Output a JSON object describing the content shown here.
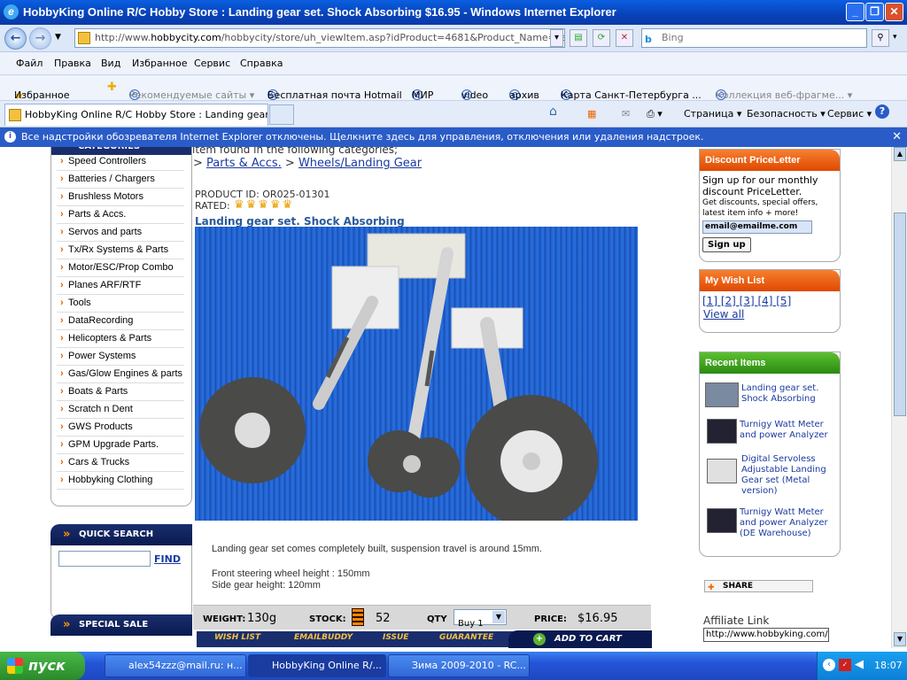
{
  "window": {
    "title": "HobbyKing Online R/C Hobby Store : Landing gear set. Shock Absorbing $16.95 - Windows Internet Explorer",
    "minimize": "_",
    "maximize": "❐",
    "close": "✕"
  },
  "address": {
    "url_prefix": "http://www.",
    "url_domain": "hobbycity.com",
    "url_rest": "/hobbycity/store/uh_viewItem.asp?idProduct=4681&Product_Name=Landing_g",
    "search_placeholder": "Bing"
  },
  "menu": [
    "Файл",
    "Правка",
    "Вид",
    "Избранное",
    "Сервис",
    "Справка"
  ],
  "favorites": {
    "label": "Избранное",
    "items": [
      "Рекомендуемые сайты ▾",
      "Бесплатная почта Hotmail",
      "МИР",
      "video",
      "архив",
      "Карта Санкт-Петербурга ...",
      "Коллекция веб-фрагме... ▾"
    ]
  },
  "tabs": {
    "active": "HobbyKing Online R/C Hobby Store : Landing gear set...",
    "tools": [
      "Страница ▾",
      "Безопасность ▾",
      "Сервис ▾"
    ]
  },
  "infobar": "Все надстройки обозревателя Internet Explorer отключены. Щелкните здесь для управления, отключения или удаления надстроек.",
  "sidebar": {
    "categories_header": "CATEGORIES",
    "categories": [
      "Speed Controllers",
      "Batteries / Chargers",
      "Brushless Motors",
      "Parts & Accs.",
      "Servos and parts",
      "Tx/Rx Systems & Parts",
      "Motor/ESC/Prop Combo",
      "Planes ARF/RTF",
      "Tools",
      "DataRecording",
      "Helicopters & Parts",
      "Power Systems",
      "Gas/Glow Engines & parts",
      "Boats & Parts",
      "Scratch n Dent",
      "GWS Products",
      "GPM Upgrade Parts.",
      "Cars & Trucks",
      "Hobbyking Clothing"
    ],
    "quick_search": "QUICK SEARCH",
    "find": "FIND",
    "special_sale": "SPECIAL SALE"
  },
  "product": {
    "found_text": "item found in the following categories;",
    "crumb_sep": ">",
    "crumb_1": "Parts & Accs.",
    "crumb_2": "Wheels/Landing Gear",
    "id_line": "PRODUCT ID: OR025-01301",
    "rated": "RATED:",
    "name": "Landing gear set. Shock Absorbing",
    "desc1": "Landing gear set comes completely built, suspension travel is around 15mm.",
    "desc2": "Front steering wheel height : 150mm",
    "desc3": "Side gear height: 120mm",
    "weight_label": "WEIGHT:",
    "weight": "130g",
    "stock_label": "STOCK:",
    "stock": "52",
    "qty_label": "QTY",
    "qty_value": "Buy 1",
    "price_label": "PRICE:",
    "price": "$16.95",
    "actions": [
      "WISH LIST",
      "EMAILBUDDY",
      "ISSUE",
      "GUARANTEE"
    ],
    "add_to_cart": "ADD TO CART"
  },
  "right": {
    "discount_header": "Discount PriceLetter",
    "discount_l1": "Sign up for our monthly",
    "discount_l2": "discount PriceLetter.",
    "discount_l3": "Get discounts, special offers,",
    "discount_l4": "latest item info + more!",
    "email_value": "email@emailme.com",
    "signup": "Sign up",
    "wish_header": "My Wish List",
    "wish_pages": "[1]  [2]  [3]  [4]  [5]",
    "view_all": "View all",
    "recent_header": "Recent Items",
    "recent": [
      "Landing gear set. Shock Absorbing",
      "Turnigy Watt Meter and power Analyzer",
      "Digital Servoless Adjustable Landing Gear set (Metal version)",
      "Turnigy Watt Meter and power Analyzer (DE Warehouse)"
    ],
    "share": "SHARE",
    "affiliate_label": "Affiliate Link",
    "affiliate_value": "http://www.hobbyking.com/h"
  },
  "taskbar": {
    "start": "пуск",
    "items": [
      "alex54zzz@mail.ru: н...",
      "HobbyKing Online R/...",
      "Зима 2009-2010 - RC..."
    ],
    "time": "18:07"
  }
}
